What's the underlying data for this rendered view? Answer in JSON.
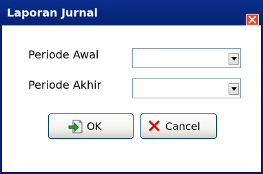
{
  "window": {
    "title": "Laporan Jurnal"
  },
  "form": {
    "start_period_label": "Periode Awal",
    "start_period_value": "",
    "end_period_label": "Periode Akhir",
    "end_period_value": ""
  },
  "buttons": {
    "ok_label": "OK",
    "cancel_label": "Cancel"
  },
  "icons": {
    "close": "close-icon",
    "dropdown": "chevron-down-icon",
    "ok": "document-arrow-icon",
    "cancel": "x-icon"
  },
  "colors": {
    "titlebar": "#08287e",
    "close_button": "#e24a2a",
    "cancel_x": "#d01010"
  }
}
